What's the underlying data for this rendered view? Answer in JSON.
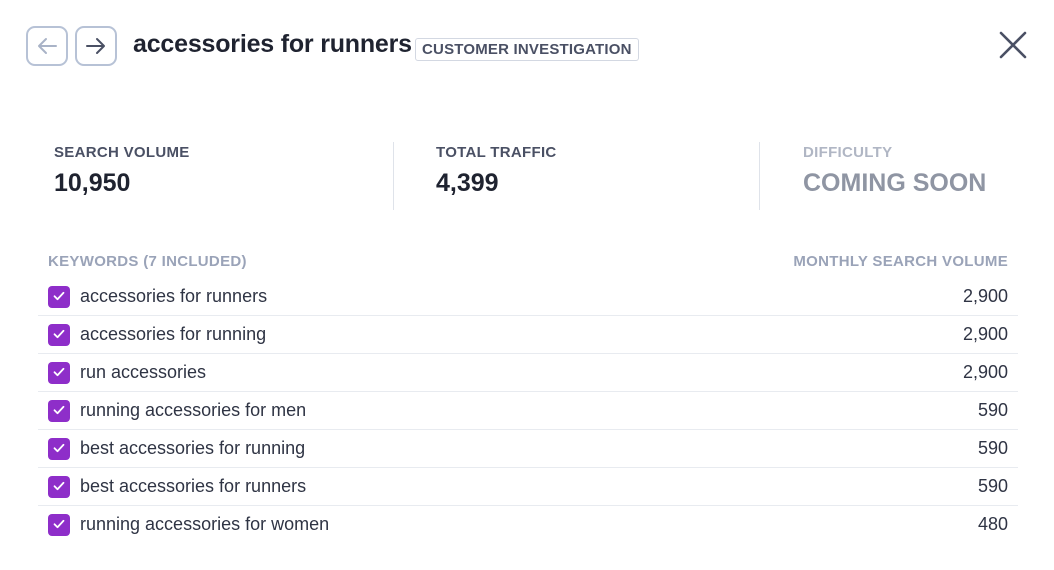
{
  "header": {
    "title": "accessories for runners",
    "badge": "CUSTOMER INVESTIGATION"
  },
  "icons": {
    "back": "arrow-left-icon",
    "forward": "arrow-right-icon",
    "close": "close-icon",
    "check": "checkmark-icon"
  },
  "stats": {
    "search_volume": {
      "label": "SEARCH VOLUME",
      "value": "10,950"
    },
    "total_traffic": {
      "label": "TOTAL TRAFFIC",
      "value": "4,399"
    },
    "difficulty": {
      "label": "DIFFICULTY",
      "value": "COMING SOON"
    }
  },
  "keywords": {
    "header_left": "KEYWORDS (7 INCLUDED)",
    "header_right": "MONTHLY SEARCH VOLUME",
    "rows": [
      {
        "keyword": "accessories for runners",
        "volume": "2,900",
        "checked": true
      },
      {
        "keyword": "accessories for running",
        "volume": "2,900",
        "checked": true
      },
      {
        "keyword": "run accessories",
        "volume": "2,900",
        "checked": true
      },
      {
        "keyword": "running accessories for men",
        "volume": "590",
        "checked": true
      },
      {
        "keyword": "best accessories for running",
        "volume": "590",
        "checked": true
      },
      {
        "keyword": "best accessories for runners",
        "volume": "590",
        "checked": true
      },
      {
        "keyword": "running accessories for women",
        "volume": "480",
        "checked": true
      }
    ]
  },
  "colors": {
    "accent": "#8e2ec9",
    "border": "#b7c2d6",
    "text": "#1f2330",
    "muted": "#9aa3b8"
  }
}
